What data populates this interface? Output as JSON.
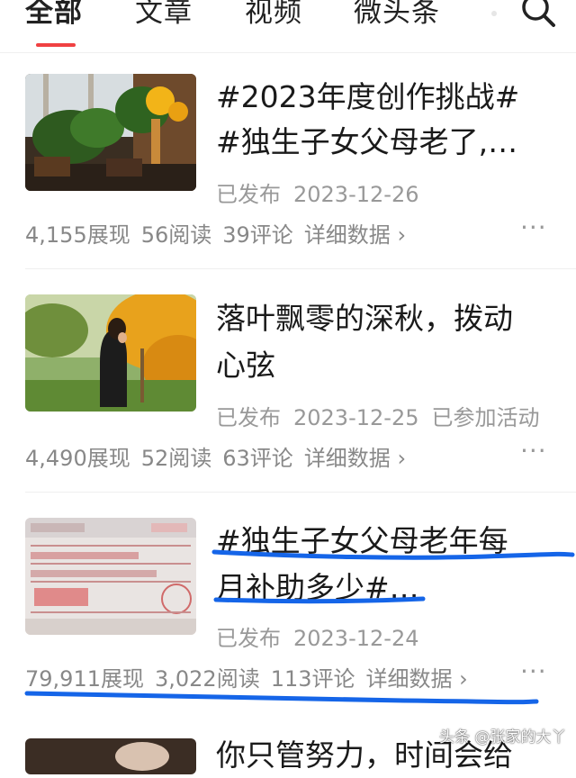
{
  "tabs": [
    "全部",
    "文章",
    "视频",
    "微头条"
  ],
  "articles": [
    {
      "title_line1": "#2023年度创作挑战#",
      "title_line2": "#独生子女父母老了,…",
      "status": "已发布",
      "date": "2023-12-26",
      "activity": "",
      "views": "4,155展现",
      "reads": "56阅读",
      "comments": "39评论",
      "detail": "详细数据 ›",
      "more": "···"
    },
    {
      "title_line1": "落叶飘零的深秋，拨动",
      "title_line2": "心弦",
      "status": "已发布",
      "date": "2023-12-25",
      "activity": "已参加活动",
      "views": "4,490展现",
      "reads": "52阅读",
      "comments": "63评论",
      "detail": "详细数据 ›",
      "more": "···"
    },
    {
      "title_line1": "#独生子女父母老年每",
      "title_line2": "月补助多少#…",
      "status": "已发布",
      "date": "2023-12-24",
      "activity": "",
      "views": "79,911展现",
      "reads": "3,022阅读",
      "comments": "113评论",
      "detail": "详细数据 ›",
      "more": "···"
    },
    {
      "title_line1": "你只管努力，时间会给"
    }
  ],
  "watermark": "头条 @张家的大丫",
  "colors": {
    "accent": "#f04142",
    "pen": "#1565e8",
    "meta": "#999999"
  }
}
